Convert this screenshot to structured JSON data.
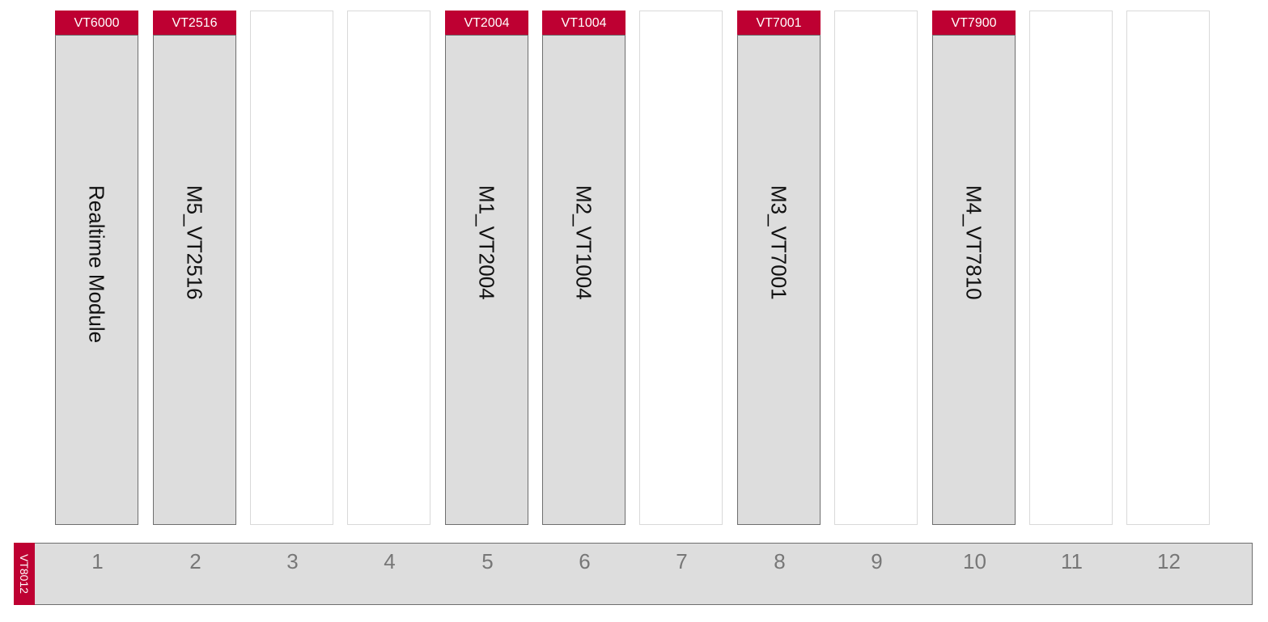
{
  "colors": {
    "accent": "#be0032",
    "module_fill": "#dddddd",
    "empty_border": "#d9d9d9",
    "number_text": "#777777"
  },
  "slots": [
    {
      "number": "1",
      "type": "VT6000",
      "name": "Realtime Module",
      "occupied": true
    },
    {
      "number": "2",
      "type": "VT2516",
      "name": "M5_VT2516",
      "occupied": true
    },
    {
      "number": "3",
      "type": "",
      "name": "",
      "occupied": false
    },
    {
      "number": "4",
      "type": "",
      "name": "",
      "occupied": false
    },
    {
      "number": "5",
      "type": "VT2004",
      "name": "M1_VT2004",
      "occupied": true
    },
    {
      "number": "6",
      "type": "VT1004",
      "name": "M2_VT1004",
      "occupied": true
    },
    {
      "number": "7",
      "type": "",
      "name": "",
      "occupied": false
    },
    {
      "number": "8",
      "type": "VT7001",
      "name": "M3_VT7001",
      "occupied": true
    },
    {
      "number": "9",
      "type": "",
      "name": "",
      "occupied": false
    },
    {
      "number": "10",
      "type": "VT7900",
      "name": "M4_VT7810",
      "occupied": true
    },
    {
      "number": "11",
      "type": "",
      "name": "",
      "occupied": false
    },
    {
      "number": "12",
      "type": "",
      "name": "",
      "occupied": false
    }
  ],
  "backplane": {
    "type": "VT8012"
  }
}
